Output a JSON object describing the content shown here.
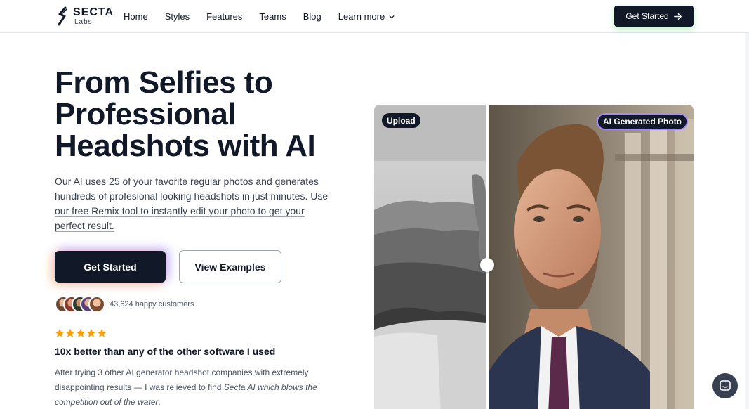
{
  "nav": {
    "logo_main": "SECTA",
    "logo_sub": "Labs",
    "links": [
      "Home",
      "Styles",
      "Features",
      "Teams",
      "Blog"
    ],
    "learn_more": "Learn more",
    "cta": "Get Started"
  },
  "hero": {
    "title": "From Selfies to Professional Headshots with AI",
    "desc_plain": "Our AI uses 25 of your favorite regular photos and generates hundreds of profesional looking headshots in just minutes. ",
    "desc_link": "Use our free Remix tool to instantly edit your photo to get your perfect result.",
    "primary_btn": "Get Started",
    "secondary_btn": "View Examples",
    "customers": "43,624 happy customers"
  },
  "review": {
    "rating": 5,
    "title": "10x better than any of the other software I used",
    "body_1": "After trying 3 other AI generator headshot companies with extremely disappointing results — I was relieved to find ",
    "body_em": "Secta AI which blows the competition out of the water",
    "body_2": "."
  },
  "compare": {
    "left_tag": "Upload",
    "right_tag": "AI Generated Photo"
  },
  "colors": {
    "dark": "#111827",
    "star": "#f59e0b",
    "accent_border": "#a78bfa"
  }
}
